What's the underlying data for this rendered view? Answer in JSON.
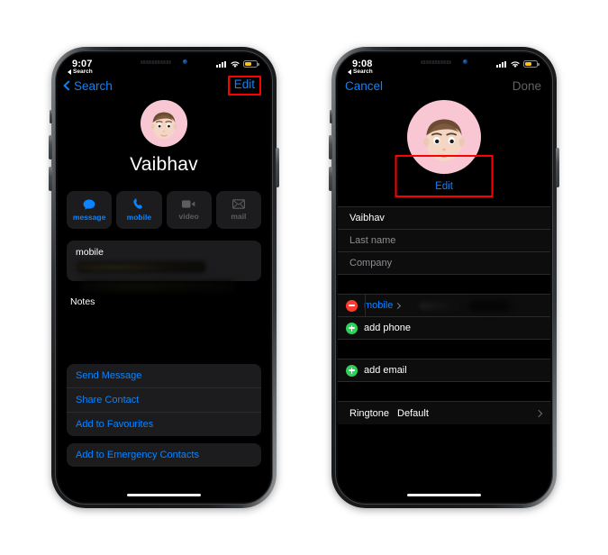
{
  "left_phone": {
    "status_bar": {
      "time": "9:07",
      "return_app": "Search",
      "battery_color": "#f5c518"
    },
    "nav": {
      "back_label": "Search",
      "action_label": "Edit",
      "action_highlighted": true
    },
    "contact": {
      "name": "Vaibhav",
      "avatar_bg": "#f9c7d4"
    },
    "actions": [
      {
        "label": "message",
        "icon": "message-bubble-icon",
        "enabled": true
      },
      {
        "label": "mobile",
        "icon": "phone-handset-icon",
        "enabled": true
      },
      {
        "label": "video",
        "icon": "video-camera-icon",
        "enabled": false
      },
      {
        "label": "mail",
        "icon": "envelope-icon",
        "enabled": false
      }
    ],
    "phone_card": {
      "label": "mobile",
      "value_redacted": true
    },
    "notes_label": "Notes",
    "links": [
      "Send Message",
      "Share Contact",
      "Add to Favourites"
    ],
    "emergency_link": "Add to Emergency Contacts"
  },
  "right_phone": {
    "status_bar": {
      "time": "9:08",
      "return_app": "Search",
      "battery_color": "#f5c518"
    },
    "nav": {
      "left_label": "Cancel",
      "right_label": "Done"
    },
    "contact": {
      "avatar_bg": "#f9c7d4",
      "edit_link": "Edit",
      "edit_highlighted": true
    },
    "fields": [
      {
        "value": "Vaibhav",
        "is_placeholder": false
      },
      {
        "value": "Last name",
        "is_placeholder": true
      },
      {
        "value": "Company",
        "is_placeholder": true
      }
    ],
    "phone_entries": [
      {
        "icon": "remove-circle-icon",
        "label": "mobile",
        "value_redacted": true
      },
      {
        "icon": "add-circle-icon",
        "label": "add phone",
        "value_redacted": false
      }
    ],
    "email_entries": [
      {
        "icon": "add-circle-icon",
        "label": "add email"
      }
    ],
    "ringtone": {
      "label": "Ringtone",
      "value": "Default"
    }
  },
  "accent": {
    "blue": "#0a84ff",
    "red": "#ff3b30",
    "green": "#30d158",
    "highlight": "#ff0000"
  }
}
